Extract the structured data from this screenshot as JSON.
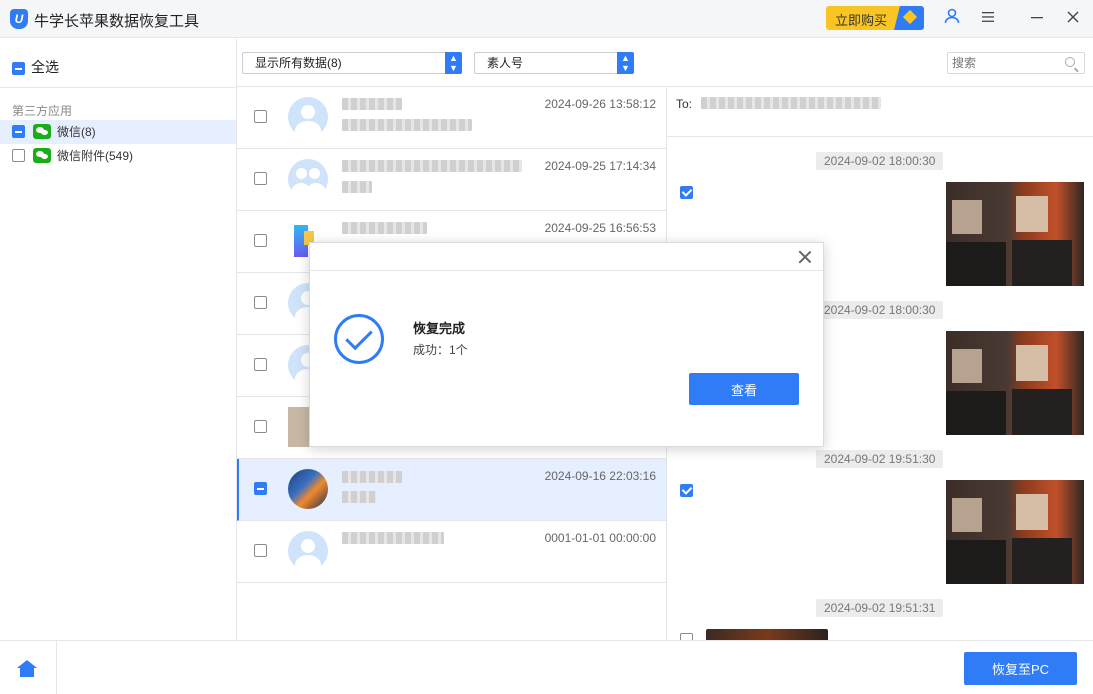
{
  "app": {
    "logo_letter": "U",
    "title": "牛学长苹果数据恢复工具",
    "buy_label": "立即购买"
  },
  "sidebar": {
    "select_all": "全选",
    "section_title": "第三方应用",
    "items": [
      {
        "label": "微信(8)",
        "state": "partial",
        "active": true
      },
      {
        "label": "微信附件(549)",
        "state": "unchecked",
        "active": false
      }
    ]
  },
  "filters": {
    "show_filter": "显示所有数据(8)",
    "contact_filter": "素人号",
    "search_placeholder": "搜索"
  },
  "contacts": [
    {
      "time": "2024-09-26 13:58:12"
    },
    {
      "time": "2024-09-25 17:14:34"
    },
    {
      "time": "2024-09-25 16:56:53"
    },
    {
      "time": ""
    },
    {
      "time": ""
    },
    {
      "time": ""
    },
    {
      "time": "2024-09-16 22:03:16"
    },
    {
      "time": "0001-01-01 00:00:00"
    }
  ],
  "messages": {
    "to_label": "To:",
    "timestamps": [
      "2024-09-02 18:00:30",
      "2024-09-02 18:00:30",
      "2024-09-02 19:51:30",
      "2024-09-02 19:51:31"
    ]
  },
  "bottom": {
    "restore_label": "恢复至PC"
  },
  "modal": {
    "title": "恢复完成",
    "subtitle": "成功：1个",
    "button": "查看"
  },
  "colors": {
    "accent": "#2f7cf6",
    "buy": "#f9c524",
    "wechat": "#1aad19"
  }
}
